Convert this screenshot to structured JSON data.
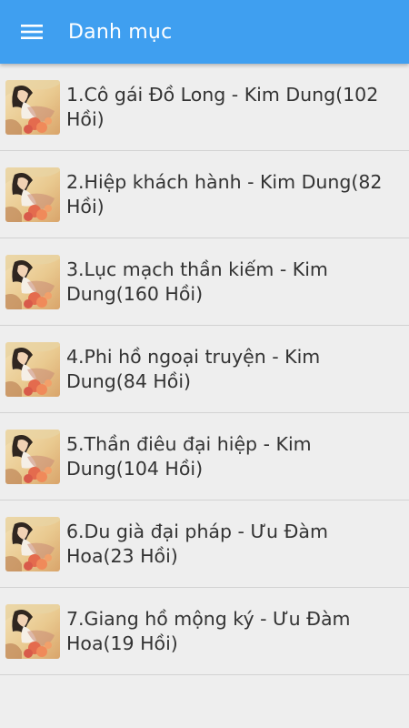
{
  "header": {
    "title": "Danh mục",
    "menu_icon": "hamburger-menu-icon",
    "background": "#3f9ff0"
  },
  "list": {
    "items": [
      {
        "label": "1.Cô gái Đồ Long - Kim Dung(102 Hồi)",
        "thumbnail": "book-cover-icon"
      },
      {
        "label": "2.Hiệp khách hành - Kim Dung(82 Hồi)",
        "thumbnail": "book-cover-icon"
      },
      {
        "label": "3.Lục mạch thần kiếm - Kim Dung(160 Hồi)",
        "thumbnail": "book-cover-icon"
      },
      {
        "label": "4.Phi hồ ngoại truyện - Kim Dung(84 Hồi)",
        "thumbnail": "book-cover-icon"
      },
      {
        "label": "5.Thần điêu đại hiệp - Kim Dung(104 Hồi)",
        "thumbnail": "book-cover-icon"
      },
      {
        "label": "6.Du già đại pháp - Ưu Đàm Hoa(23 Hồi)",
        "thumbnail": "book-cover-icon"
      },
      {
        "label": "7.Giang hồ mộng ký - Ưu Đàm Hoa(19 Hồi)",
        "thumbnail": "book-cover-icon"
      }
    ]
  }
}
